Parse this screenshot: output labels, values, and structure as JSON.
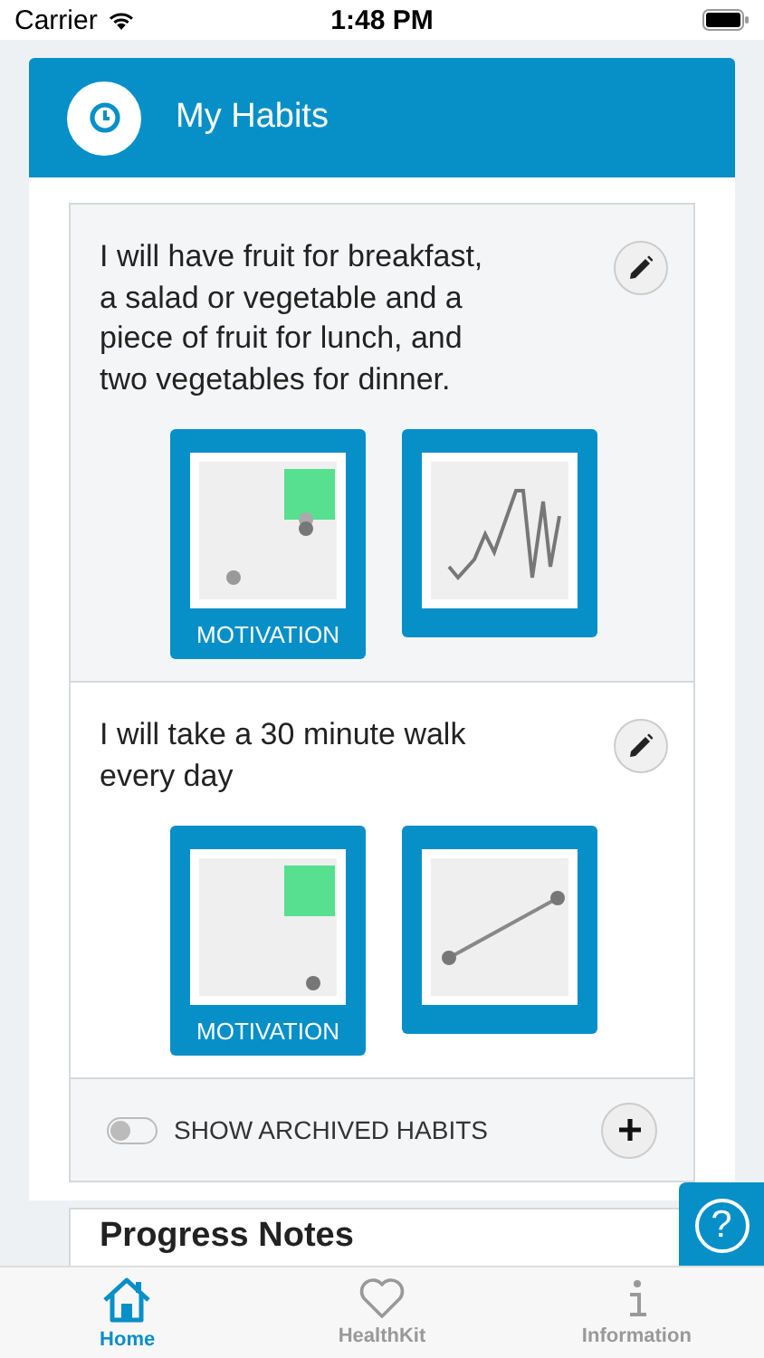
{
  "status_bar": {
    "carrier": "Carrier",
    "time": "1:48 PM"
  },
  "header": {
    "title": "My Habits"
  },
  "habits": [
    {
      "text": "I will have fruit for breakfast, a salad or vegetable and a piece of fruit for lunch, and two vegetables for dinner.",
      "motivation_label": "MOTIVATION"
    },
    {
      "text": "I will take a 30 minute walk every day",
      "motivation_label": "MOTIVATION"
    }
  ],
  "archived_toggle": {
    "label": "SHOW ARCHIVED HABITS",
    "on": false
  },
  "progress_notes": {
    "title": "Progress Notes"
  },
  "help_button": {
    "label": "?"
  },
  "tabs": [
    {
      "label": "Home",
      "kind": "home",
      "selected": true
    },
    {
      "label": "HealthKit",
      "kind": "heart",
      "selected": false
    },
    {
      "label": "Information",
      "kind": "info",
      "selected": false
    }
  ]
}
